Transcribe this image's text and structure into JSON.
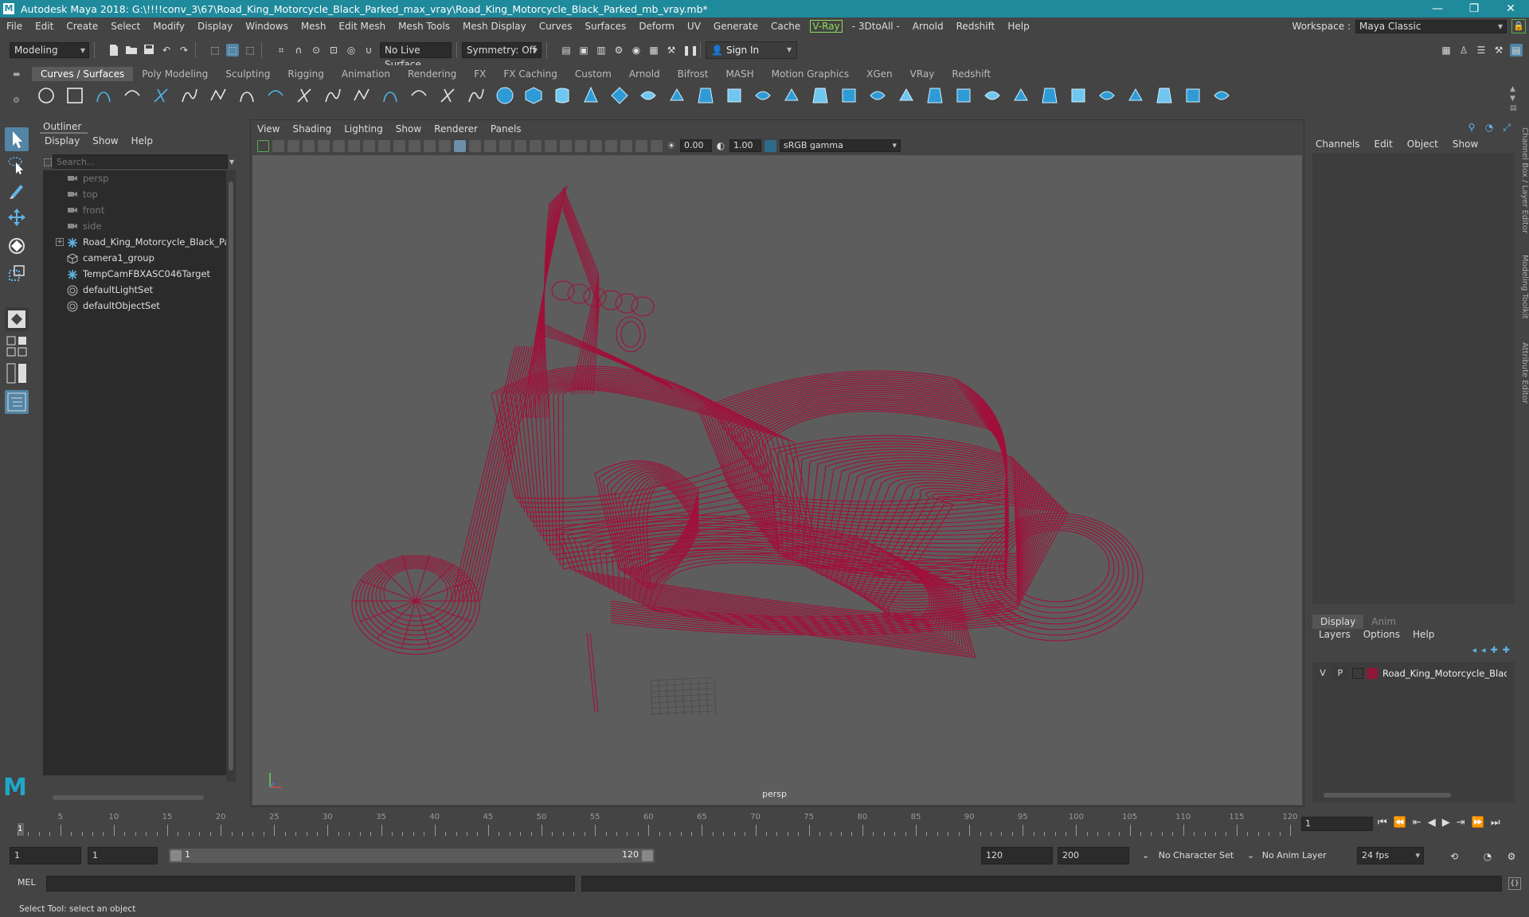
{
  "window": {
    "title": "Autodesk Maya 2018: G:\\!!!!conv_3\\67\\Road_King_Motorcycle_Black_Parked_max_vray\\Road_King_Motorcycle_Black_Parked_mb_vray.mb*",
    "minimize": "—",
    "maximize": "❐",
    "close": "✕"
  },
  "menubar": {
    "items": [
      "File",
      "Edit",
      "Create",
      "Select",
      "Modify",
      "Display",
      "Windows",
      "Mesh",
      "Edit Mesh",
      "Mesh Tools",
      "Mesh Display",
      "Curves",
      "Surfaces",
      "Deform",
      "UV",
      "Generate",
      "Cache",
      "V-Ray",
      "- 3DtoAll -",
      "Arnold",
      "Redshift",
      "Help"
    ],
    "workspace_label": "Workspace :",
    "workspace_value": "Maya Classic"
  },
  "statusline": {
    "mode": "Modeling",
    "live_surface": "No Live Surface",
    "symmetry": "Symmetry: Off",
    "sign_in": "Sign In"
  },
  "shelf": {
    "tabs": [
      "Curves / Surfaces",
      "Poly Modeling",
      "Sculpting",
      "Rigging",
      "Animation",
      "Rendering",
      "FX",
      "FX Caching",
      "Custom",
      "Arnold",
      "Bifrost",
      "MASH",
      "Motion Graphics",
      "XGen",
      "VRay",
      "Redshift"
    ],
    "active_tab": "Curves / Surfaces"
  },
  "outliner": {
    "title": "Outliner",
    "menus": [
      "Display",
      "Show",
      "Help"
    ],
    "search_placeholder": "Search...",
    "items": [
      {
        "label": "persp",
        "kind": "camera",
        "icon": "camera-icon"
      },
      {
        "label": "top",
        "kind": "camera",
        "icon": "camera-icon"
      },
      {
        "label": "front",
        "kind": "camera",
        "icon": "camera-icon"
      },
      {
        "label": "side",
        "kind": "camera",
        "icon": "camera-icon"
      },
      {
        "label": "Road_King_Motorcycle_Black_Parked_",
        "kind": "group",
        "icon": "asterisk-icon",
        "expandable": true
      },
      {
        "label": "camera1_group",
        "kind": "group",
        "icon": "group-icon"
      },
      {
        "label": "TempCamFBXASC046Target",
        "kind": "transform",
        "icon": "asterisk-icon"
      },
      {
        "label": "defaultLightSet",
        "kind": "set",
        "icon": "set-icon"
      },
      {
        "label": "defaultObjectSet",
        "kind": "set",
        "icon": "set-icon"
      }
    ]
  },
  "viewport": {
    "menus": [
      "View",
      "Shading",
      "Lighting",
      "Show",
      "Renderer",
      "Panels"
    ],
    "exposure": "0.00",
    "gamma": "1.00",
    "color_space": "sRGB gamma",
    "camera_label": "persp",
    "wire_color": "#a0103a"
  },
  "channelbox": {
    "menus": [
      "Channels",
      "Edit",
      "Object",
      "Show"
    ],
    "layer_tabs": [
      "Display",
      "Anim"
    ],
    "layer_menus": [
      "Layers",
      "Options",
      "Help"
    ],
    "layer": {
      "v": "V",
      "p": "P",
      "name": "Road_King_Motorcycle_Black_Parked",
      "color": "#8e1838"
    },
    "side_tabs": [
      "Channel Box / Layer Editor",
      "Modeling Toolkit",
      "Attribute Editor"
    ]
  },
  "timeslider": {
    "ticks": [
      "5",
      "10",
      "15",
      "20",
      "25",
      "30",
      "35",
      "40",
      "45",
      "50",
      "55",
      "60",
      "65",
      "70",
      "75",
      "80",
      "85",
      "90",
      "95",
      "100",
      "105",
      "110",
      "115",
      "120"
    ],
    "current_frame_marker": "1",
    "current_frame": "1"
  },
  "range": {
    "start": "1",
    "playback_start": "1",
    "slider_start": "1",
    "slider_end": "120",
    "playback_end": "120",
    "end": "200",
    "character_set": "No Character Set",
    "anim_layer": "No Anim Layer",
    "fps": "24 fps"
  },
  "cmdline": {
    "label": "MEL"
  },
  "helpline": {
    "text": "Select Tool: select an object"
  }
}
